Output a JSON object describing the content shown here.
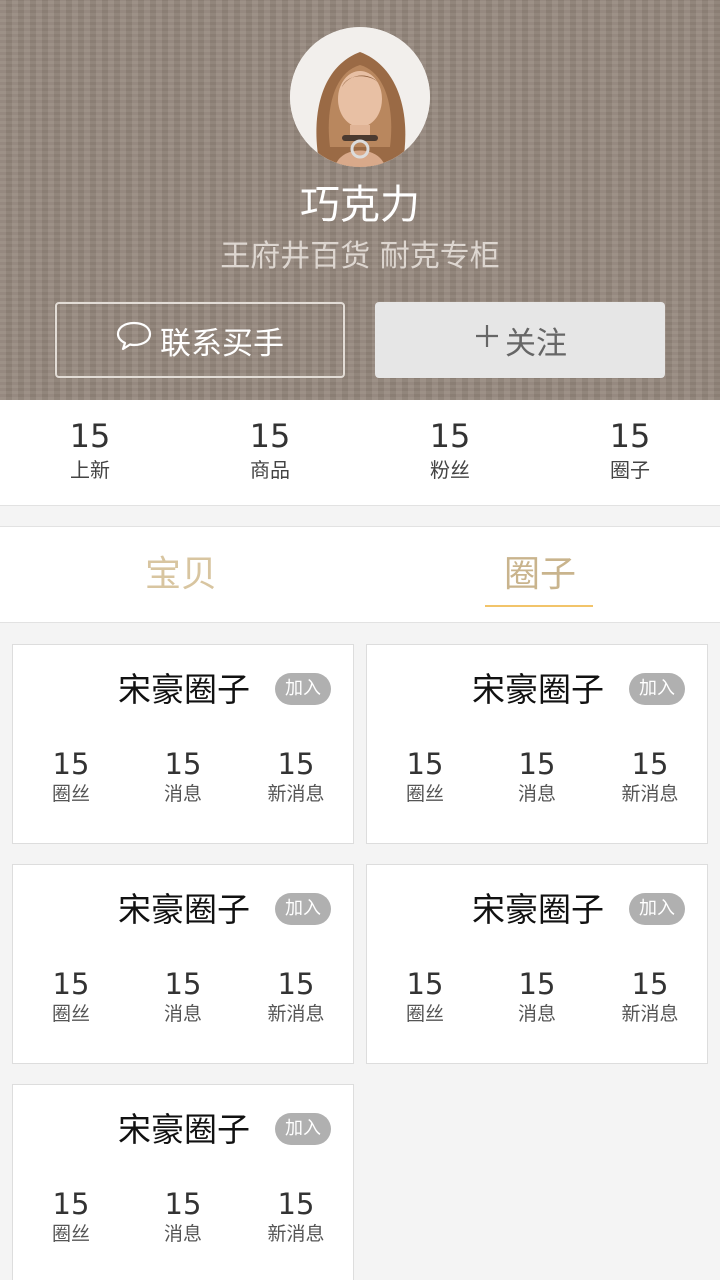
{
  "profile": {
    "name": "巧克力",
    "subtitle": "王府井百货 耐克专柜",
    "contact_label": "联系买手",
    "follow_label": "关注"
  },
  "stats": [
    {
      "value": "15",
      "label": "上新"
    },
    {
      "value": "15",
      "label": "商品"
    },
    {
      "value": "15",
      "label": "粉丝"
    },
    {
      "value": "15",
      "label": "圈子"
    }
  ],
  "tabs": [
    {
      "label": "宝贝",
      "active": false
    },
    {
      "label": "圈子",
      "active": true
    }
  ],
  "circles": [
    {
      "title": "宋豪圈子",
      "join_label": "加入",
      "stats": [
        {
          "value": "15",
          "label": "圈丝"
        },
        {
          "value": "15",
          "label": "消息"
        },
        {
          "value": "15",
          "label": "新消息"
        }
      ]
    },
    {
      "title": "宋豪圈子",
      "join_label": "加入",
      "stats": [
        {
          "value": "15",
          "label": "圈丝"
        },
        {
          "value": "15",
          "label": "消息"
        },
        {
          "value": "15",
          "label": "新消息"
        }
      ]
    },
    {
      "title": "宋豪圈子",
      "join_label": "加入",
      "stats": [
        {
          "value": "15",
          "label": "圈丝"
        },
        {
          "value": "15",
          "label": "消息"
        },
        {
          "value": "15",
          "label": "新消息"
        }
      ]
    },
    {
      "title": "宋豪圈子",
      "join_label": "加入",
      "stats": [
        {
          "value": "15",
          "label": "圈丝"
        },
        {
          "value": "15",
          "label": "消息"
        },
        {
          "value": "15",
          "label": "新消息"
        }
      ]
    },
    {
      "title": "宋豪圈子",
      "join_label": "加入",
      "stats": [
        {
          "value": "15",
          "label": "圈丝"
        },
        {
          "value": "15",
          "label": "消息"
        },
        {
          "value": "15",
          "label": "新消息"
        }
      ]
    }
  ],
  "colors": {
    "header_bg": "#95877d",
    "tab_active": "#c9b48d",
    "tab_underline": "#f2c46a",
    "join_badge": "#b0b0b0"
  },
  "icons": {
    "contact": "speech-bubble-icon",
    "follow": "plus-icon"
  }
}
